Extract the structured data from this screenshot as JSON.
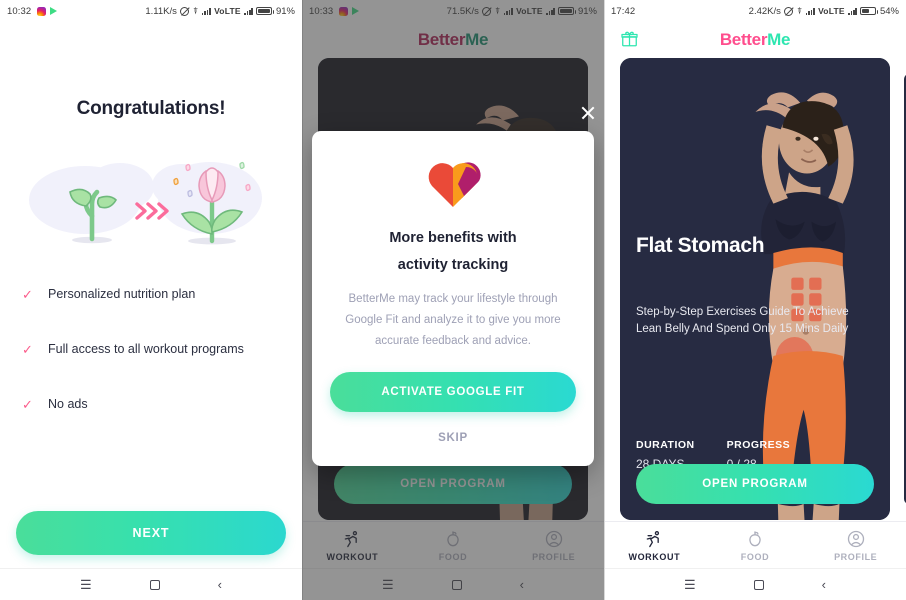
{
  "panels": [
    {
      "status": {
        "time": "10:32",
        "net_speed": "1.11K/s",
        "network": "VoLTE",
        "battery": "91%"
      },
      "title": "Congratulations!",
      "illustration": "sprout-to-flower-growth-illustration",
      "benefits": [
        "Personalized nutrition plan",
        "Full access to all workout programs",
        "No ads"
      ],
      "next_button": "NEXT"
    },
    {
      "status": {
        "time": "10:33",
        "net_speed": "71.5K/s",
        "network": "VoLTE",
        "battery": "91%"
      },
      "logo": {
        "first": "Better",
        "second": "Me"
      },
      "dialog": {
        "icon": "google-fit-heart-icon",
        "title_line1": "More benefits with",
        "title_line2": "activity tracking",
        "body_line1": "BetterMe may track your lifestyle through",
        "body_line2": "Google Fit and analyze it to give you more",
        "body_line3": "accurate feedback and advice.",
        "activate_label": "ACTIVATE GOOGLE FIT",
        "skip_label": "SKIP",
        "close_label": "close-icon"
      },
      "tabs": [
        {
          "label": "WORKOUT",
          "icon": "running-person-icon",
          "active": true
        },
        {
          "label": "FOOD",
          "icon": "apple-icon",
          "active": false
        },
        {
          "label": "PROFILE",
          "icon": "user-circle-icon",
          "active": false
        }
      ]
    },
    {
      "status": {
        "time": "17:42",
        "net_speed": "2.42K/s",
        "network": "VoLTE",
        "battery": "54%"
      },
      "logo": {
        "first": "Better",
        "second": "Me"
      },
      "gift_icon": "gift-icon",
      "card": {
        "title": "Flat Stomach",
        "subtitle_line1": "Step-by-Step Exercises Guide To Achieve",
        "subtitle_line2": "Lean Belly And Spend Only 15 Mins Daily",
        "duration_label": "DURATION",
        "duration_value": "28 DAYS",
        "progress_label": "PROGRESS",
        "progress_value": "0 / 28",
        "open_label": "OPEN PROGRAM"
      },
      "tabs": [
        {
          "label": "WORKOUT",
          "icon": "running-person-icon",
          "active": true
        },
        {
          "label": "FOOD",
          "icon": "apple-icon",
          "active": false
        },
        {
          "label": "PROFILE",
          "icon": "user-circle-icon",
          "active": false
        }
      ]
    }
  ],
  "nav": {
    "menu": "menu-icon",
    "home": "home-square-icon",
    "back": "back-chevron-icon"
  },
  "colors": {
    "accent_green": "#35e0b0",
    "accent_pink": "#ff4d8d",
    "check_pink": "#fb5c8b",
    "card_navy": "#272b42",
    "text_dark": "#1f2233",
    "text_muted": "#9ea0b5"
  }
}
